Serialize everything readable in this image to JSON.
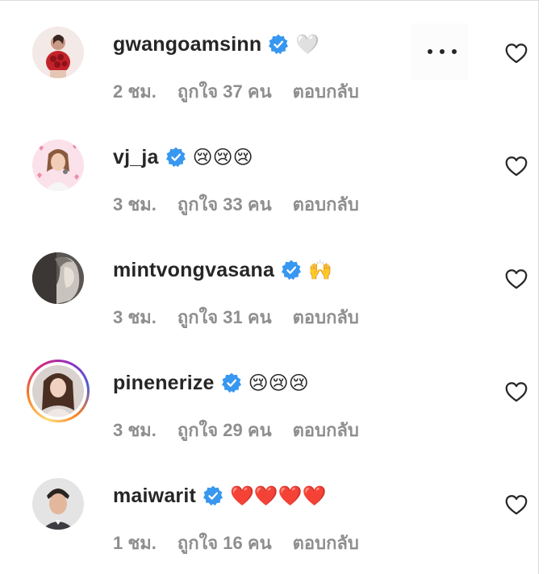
{
  "comments": [
    {
      "username": "gwangoamsinn",
      "text": "🤍",
      "time": "2 ชม.",
      "likes": "ถูกใจ 37 คน",
      "reply": "ตอบกลับ",
      "has_more_menu": true,
      "story_ring": false,
      "avatar_icon": "avatar-photo-roses"
    },
    {
      "username": "vj_ja",
      "text": "😢😢😢",
      "time": "3 ชม.",
      "likes": "ถูกใจ 33 คน",
      "reply": "ตอบกลับ",
      "has_more_menu": false,
      "story_ring": false,
      "avatar_icon": "avatar-photo-hearts"
    },
    {
      "username": "mintvongvasana",
      "text": "🙌",
      "time": "3 ชม.",
      "likes": "ถูกใจ 31 คน",
      "reply": "ตอบกลับ",
      "has_more_menu": false,
      "story_ring": false,
      "avatar_icon": "avatar-photo-bw"
    },
    {
      "username": "pinenerize",
      "text": "😢😢😢",
      "time": "3 ชม.",
      "likes": "ถูกใจ 29 คน",
      "reply": "ตอบกลับ",
      "has_more_menu": false,
      "story_ring": true,
      "avatar_icon": "avatar-photo-portrait"
    },
    {
      "username": "maiwarit",
      "text": "❤️❤️❤️❤️",
      "time": "1 ชม.",
      "likes": "ถูกใจ 16 คน",
      "reply": "ตอบกลับ",
      "has_more_menu": false,
      "story_ring": false,
      "avatar_icon": "avatar-photo-man"
    }
  ],
  "colors": {
    "verified": "#3897f0",
    "meta_text": "#8e8e8e",
    "username": "#262626"
  }
}
